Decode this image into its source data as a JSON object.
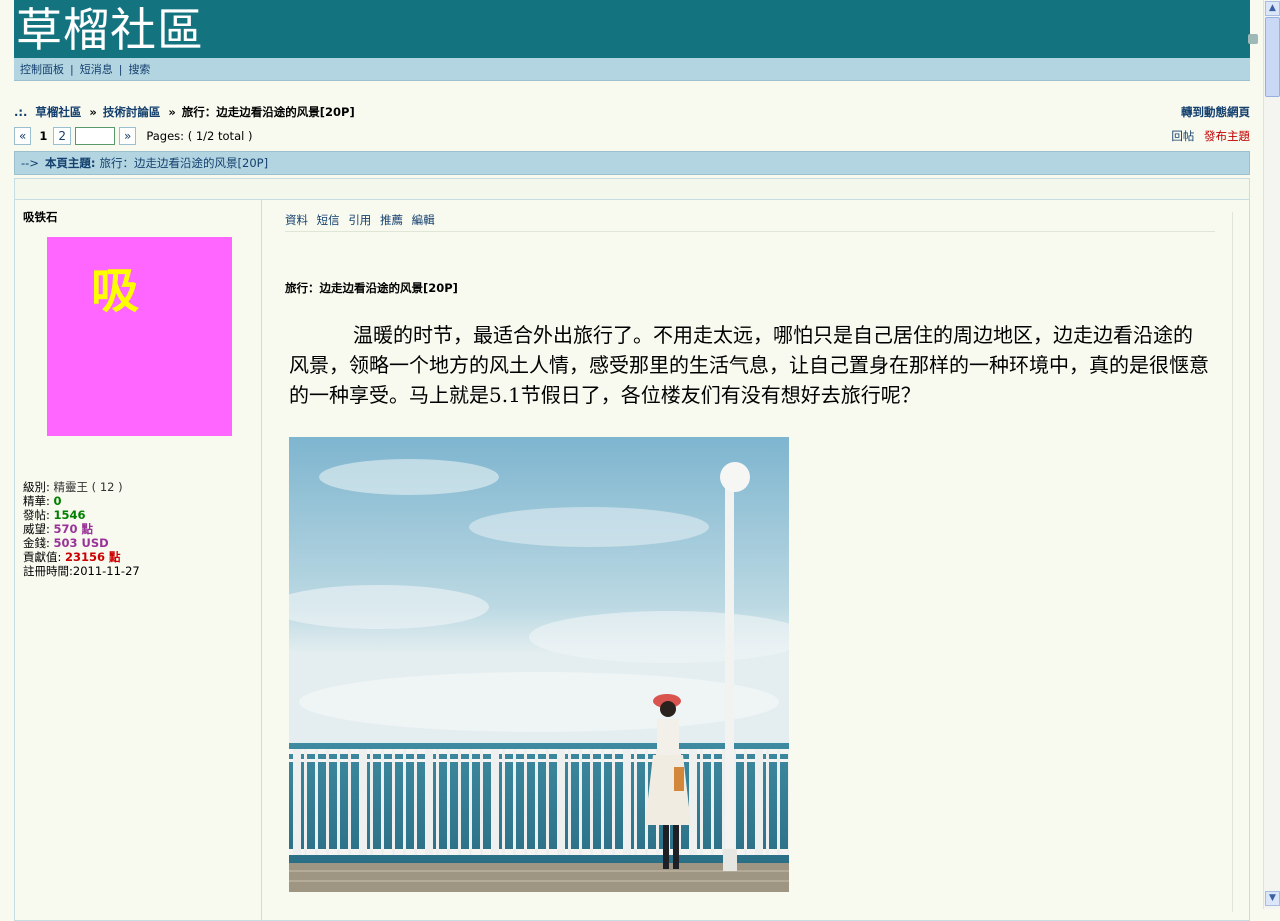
{
  "header": {
    "logo": "草榴社區"
  },
  "nav": {
    "control_panel": "控制面板",
    "messages": "短消息",
    "search": "搜索",
    "sep": "|"
  },
  "breadcrumb": {
    "lead": ".:.",
    "home": "草榴社區",
    "arrow": "»",
    "forum": "技術討論區",
    "current": "旅行：边走边看沿途的风景[20P]",
    "dynamic_link": "轉到動態網頁"
  },
  "pager": {
    "prev": "«",
    "current": "1",
    "page2": "2",
    "next": "»",
    "info": "Pages: ( 1/2 total )"
  },
  "actions": {
    "reply": "回帖",
    "new_topic": "發布主題"
  },
  "topic_bar": {
    "arrow": "-->",
    "label": "本頁主題:",
    "title": "旅行：边走边看沿途的风景[20P]"
  },
  "user": {
    "name": "吸铁石",
    "avatar_char": "吸",
    "level_label": "級別:",
    "level_value": "精靈王 ( 12 )",
    "elite_label": "精華:",
    "elite_value": "0",
    "posts_label": "發帖:",
    "posts_value": "1546",
    "prestige_label": "威望:",
    "prestige_value": "570 點",
    "money_label": "金錢:",
    "money_value": "503 USD",
    "contrib_label": "貢獻值:",
    "contrib_value": "23156 點",
    "reg_label": "註冊時間:",
    "reg_value": "2011-11-27"
  },
  "post": {
    "links": [
      "資料",
      "短信",
      "引用",
      "推薦",
      "編輯"
    ],
    "title": "旅行：边走边看沿途的风景[20P]",
    "body": "温暖的时节，最适合外出旅行了。不用走太远，哪怕只是自己居住的周边地区，边走边看沿途的风景，领略一个地方的风土人情，感受那里的生活气息，让自己置身在那样的一种环境中，真的是很惬意的一种享受。马上就是5.1节假日了，各位楼友们有没有想好去旅行呢？"
  },
  "colors": {
    "banner": "#137480",
    "nav": "#b3d5e1",
    "link": "#14406e",
    "avatar_bg": "#ff66ff",
    "avatar_text": "#ffff00"
  }
}
